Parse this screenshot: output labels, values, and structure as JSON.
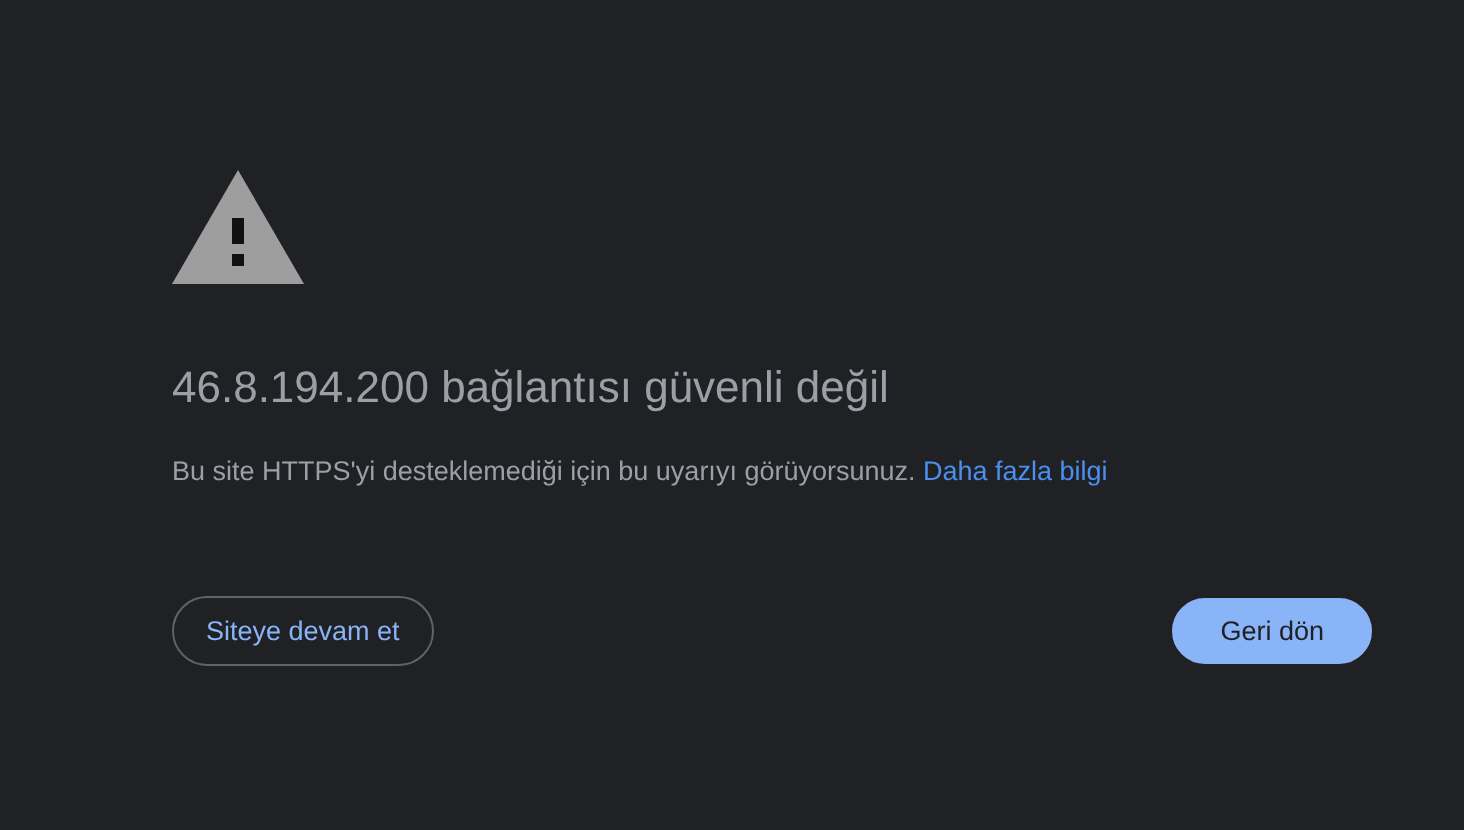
{
  "heading": "46.8.194.200 bağlantısı güvenli değil",
  "message": {
    "text": "Bu site HTTPS'yi desteklemediği için bu uyarıyı görüyorsunuz.",
    "link": "Daha fazla bilgi"
  },
  "buttons": [
    {
      "label": "Siteye devam et",
      "kind": "outline"
    },
    {
      "label": "Geri dön",
      "kind": "primary"
    }
  ]
}
